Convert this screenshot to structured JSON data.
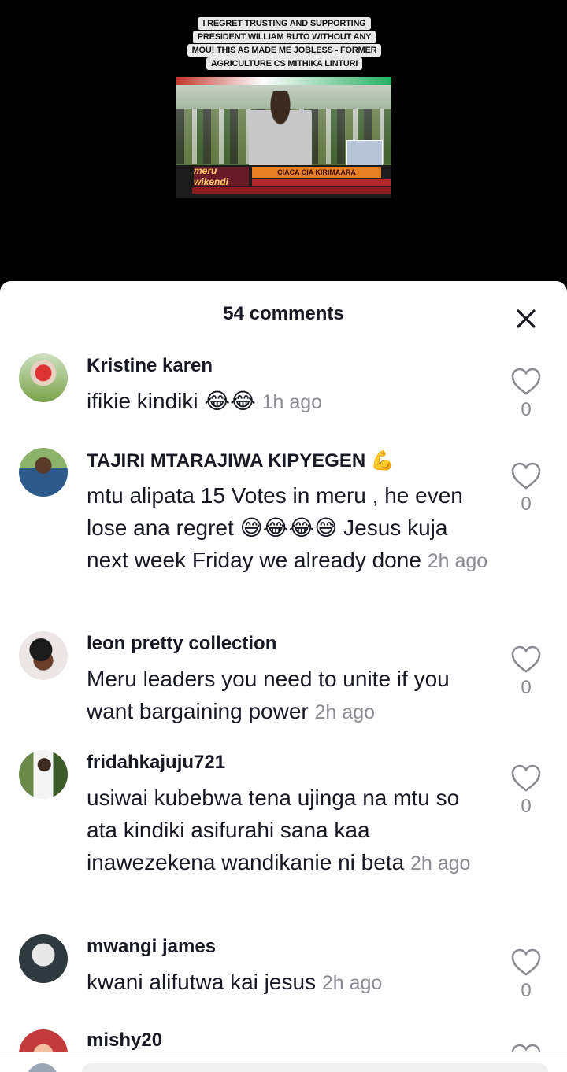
{
  "video": {
    "caption_lines": [
      "I REGRET TRUSTING AND SUPPORTING",
      "PRESIDENT WILLIAM RUTO WITHOUT ANY",
      "MOU! THIS AS MADE ME JOBLESS - FORMER",
      "AGRICULTURE CS MITHIKA LINTURI"
    ],
    "channel_logo": "meru wikendi",
    "headline": "CIACA CIA KIRIMAARA"
  },
  "comments_panel": {
    "title": "54 comments",
    "close_icon": "close-icon"
  },
  "comments": [
    {
      "user": "Kristine karen",
      "text": "ifikie kindiki 😂😂",
      "time": "1h ago",
      "likes": "0",
      "avatar_color": "#7aa34a"
    },
    {
      "user": "TAJIRI MTARAJIWA KIPYEGEN 💪",
      "text": "mtu alipata 15 Votes in meru , he even lose ana regret 😅😂😂😅 Jesus kuja next week Friday we already done",
      "time": "2h ago",
      "likes": "0",
      "avatar_color": "#4a7a3a"
    },
    {
      "user": "leon pretty collection",
      "text": "Meru leaders you need to unite if you want bargaining power",
      "time": "2h ago",
      "likes": "0",
      "avatar_color": "#d9c9c4"
    },
    {
      "user": "fridahkajuju721",
      "text": "usiwai kubebwa tena ujinga na mtu so ata kindiki asifurahi sana kaa inawezekena wandikanie ni beta",
      "time": "2h ago",
      "likes": "0",
      "avatar_color": "#6b8a4a"
    },
    {
      "user": "mwangi james",
      "text": "kwani alifutwa kai jesus",
      "time": "2h ago",
      "likes": "0",
      "avatar_color": "#2f3a3f"
    },
    {
      "user": "mishy20",
      "text": "",
      "time": "",
      "likes": "",
      "avatar_color": "#c23a3a"
    }
  ]
}
